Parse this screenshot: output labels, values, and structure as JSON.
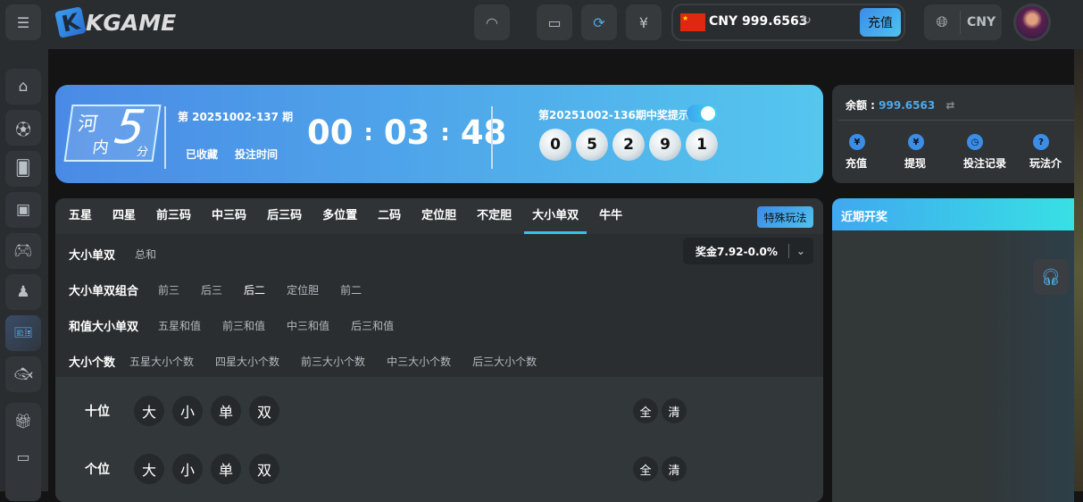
{
  "header": {
    "logo": "KGAME",
    "balance": "CNY 999.6563",
    "deposit": "充值",
    "currency": "CNY",
    "flag": "CN"
  },
  "sidebar": {
    "items": [
      "home-icon",
      "football-icon",
      "cards-icon",
      "slot-machine-icon",
      "gamepad-icon",
      "chess-icon",
      "lottery-icon",
      "fish-icon",
      "gift-icon",
      "wallet-icon"
    ],
    "active": 6
  },
  "banner": {
    "game_logo_line1": "河",
    "game_logo_line2": "内",
    "game_logo_num": "5",
    "game_logo_unit": "分",
    "period": "第 20251002-137 期",
    "favorite": "已收藏",
    "bet_time": "投注时间",
    "hh": "00",
    "mm": "03",
    "ss": "48",
    "sep": ":",
    "last_result_label": "第20251002-136期中奖提示",
    "notify_on": true,
    "balls": [
      "0",
      "5",
      "2",
      "9",
      "1"
    ]
  },
  "account": {
    "balance_label": "余额 :",
    "balance": "999.6563",
    "actions": [
      "充值",
      "提现",
      "投注记录",
      "玩法介"
    ]
  },
  "tabs": {
    "items": [
      "五星",
      "四星",
      "前三码",
      "中三码",
      "后三码",
      "多位置",
      "二码",
      "定位胆",
      "不定胆",
      "大小单双",
      "牛牛"
    ],
    "active": 9,
    "special": "特殊玩法"
  },
  "subplays": [
    {
      "label": "大小单双",
      "items": [
        "总和"
      ],
      "selected": -1
    },
    {
      "label": "大小单双组合",
      "items": [
        "前三",
        "后三",
        "后二",
        "定位胆",
        "前二"
      ],
      "selected": 2
    },
    {
      "label": "和值大小单双",
      "items": [
        "五星和值",
        "前三和值",
        "中三和值",
        "后三和值"
      ],
      "selected": -1
    },
    {
      "label": "大小个数",
      "items": [
        "五星大小个数",
        "四星大小个数",
        "前三大小个数",
        "中三大小个数",
        "后三大小个数"
      ],
      "selected": -1
    }
  ],
  "odds": "奖金7.92-0.0%",
  "positions": [
    {
      "label": "十位",
      "options": [
        "大",
        "小",
        "单",
        "双"
      ],
      "all": "全",
      "clear": "清"
    },
    {
      "label": "个位",
      "options": [
        "大",
        "小",
        "单",
        "双"
      ],
      "all": "全",
      "clear": "清"
    }
  ],
  "recent": {
    "title": "近期开奖"
  },
  "colors": {
    "accent": "#4fc3ee",
    "bg": "#141414",
    "panel": "#2f3335"
  }
}
